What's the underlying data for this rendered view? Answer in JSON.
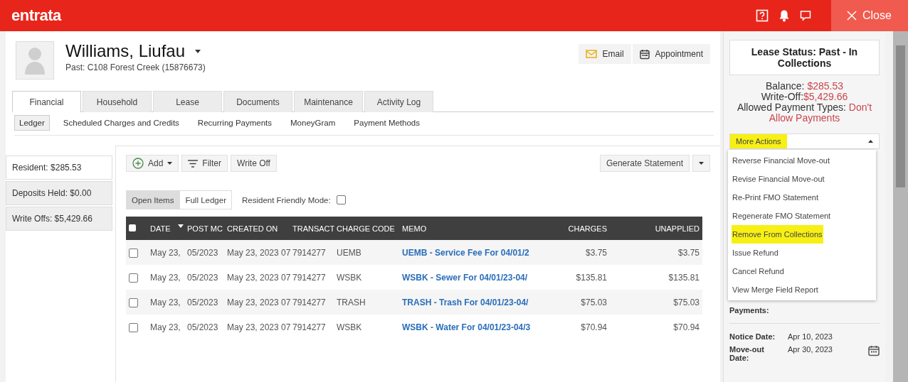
{
  "header": {
    "logo": "entrata",
    "close": "Close"
  },
  "resident": {
    "name": "Williams, Liufau",
    "subtitle": "Past: C108 Forest Creek (15876673)",
    "actions": [
      "Email",
      "Appointment"
    ]
  },
  "tabs": [
    {
      "label": "Financial",
      "selected": true
    },
    {
      "label": "Household",
      "selected": false
    },
    {
      "label": "Lease",
      "selected": false
    },
    {
      "label": "Documents",
      "selected": false
    },
    {
      "label": "Maintenance",
      "selected": false
    },
    {
      "label": "Activity Log",
      "selected": false
    }
  ],
  "subtabs": [
    {
      "label": "Ledger",
      "selected": true
    },
    {
      "label": "Scheduled Charges and Credits",
      "selected": false
    },
    {
      "label": "Recurring Payments",
      "selected": false
    },
    {
      "label": "MoneyGram",
      "selected": false
    },
    {
      "label": "Payment Methods",
      "selected": false
    }
  ],
  "summary": [
    {
      "label": "Resident: $285.53",
      "selected": true
    },
    {
      "label": "Deposits Held: $0.00",
      "selected": false
    },
    {
      "label": "Write Offs: $5,429.66",
      "selected": false
    }
  ],
  "toolbar": {
    "add": "Add",
    "filter": "Filter",
    "write_off": "Write Off",
    "generate": "Generate Statement"
  },
  "view_toggle": [
    {
      "label": "Open Items",
      "selected": true
    },
    {
      "label": "Full Ledger",
      "selected": false
    }
  ],
  "friendly_mode": {
    "label": "Resident Friendly Mode:",
    "checked": false
  },
  "table": {
    "select_all": false,
    "columns": [
      "DATE",
      "POST MC",
      "CREATED ON",
      "TRANSACT",
      "CHARGE CODE",
      "MEMO",
      "CHARGES",
      "UNAPPLIED"
    ],
    "rows": [
      {
        "checked": false,
        "cells": [
          "May 23,",
          "05/2023",
          "May 23, 2023 07",
          "7914277",
          "UEMB",
          "UEMB - Service Fee For 04/01/2",
          "$3.75",
          "$3.75"
        ]
      },
      {
        "checked": false,
        "cells": [
          "May 23,",
          "05/2023",
          "May 23, 2023 07",
          "7914277",
          "WSBK",
          "WSBK - Sewer For 04/01/23-04/",
          "$135.81",
          "$135.81"
        ]
      },
      {
        "checked": false,
        "cells": [
          "May 23,",
          "05/2023",
          "May 23, 2023 07",
          "7914277",
          "TRASH",
          "TRASH - Trash For 04/01/23-04/",
          "$75.03",
          "$75.03"
        ]
      },
      {
        "checked": false,
        "cells": [
          "May 23,",
          "05/2023",
          "May 23, 2023 07",
          "7914277",
          "WSBK",
          "WSBK - Water For 04/01/23-04/3",
          "$70.94",
          "$70.94"
        ]
      }
    ]
  },
  "lease_panel": {
    "status": "Lease Status: Past - In Collections",
    "lines": [
      {
        "label": "Balance: ",
        "value": "$285.53"
      },
      {
        "label": "Write-Off:",
        "value": "$5,429.66"
      },
      {
        "label": "Allowed Payment Types: ",
        "value": "Don't Allow Payments"
      }
    ],
    "more_actions": {
      "label": "More Actions",
      "expanded": true,
      "highlighted": true
    },
    "menu": [
      {
        "label": "Reverse Financial Move-out",
        "highlighted": false
      },
      {
        "label": "Revise Financial Move-out",
        "highlighted": false
      },
      {
        "label": "Re-Print FMO Statement",
        "highlighted": false
      },
      {
        "label": "Regenerate FMO Statement",
        "highlighted": false
      },
      {
        "label": "Remove From Collections",
        "highlighted": true
      },
      {
        "label": "Issue Refund",
        "highlighted": false
      },
      {
        "label": "Cancel Refund",
        "highlighted": false
      },
      {
        "label": "View Merge Field Report",
        "highlighted": false
      }
    ],
    "partial_label": "Payments:",
    "dates": [
      {
        "label": "Notice Date:",
        "value": "Apr 10, 2023"
      },
      {
        "label": "Move-out Date:",
        "value": "Apr 30, 2023"
      }
    ]
  }
}
